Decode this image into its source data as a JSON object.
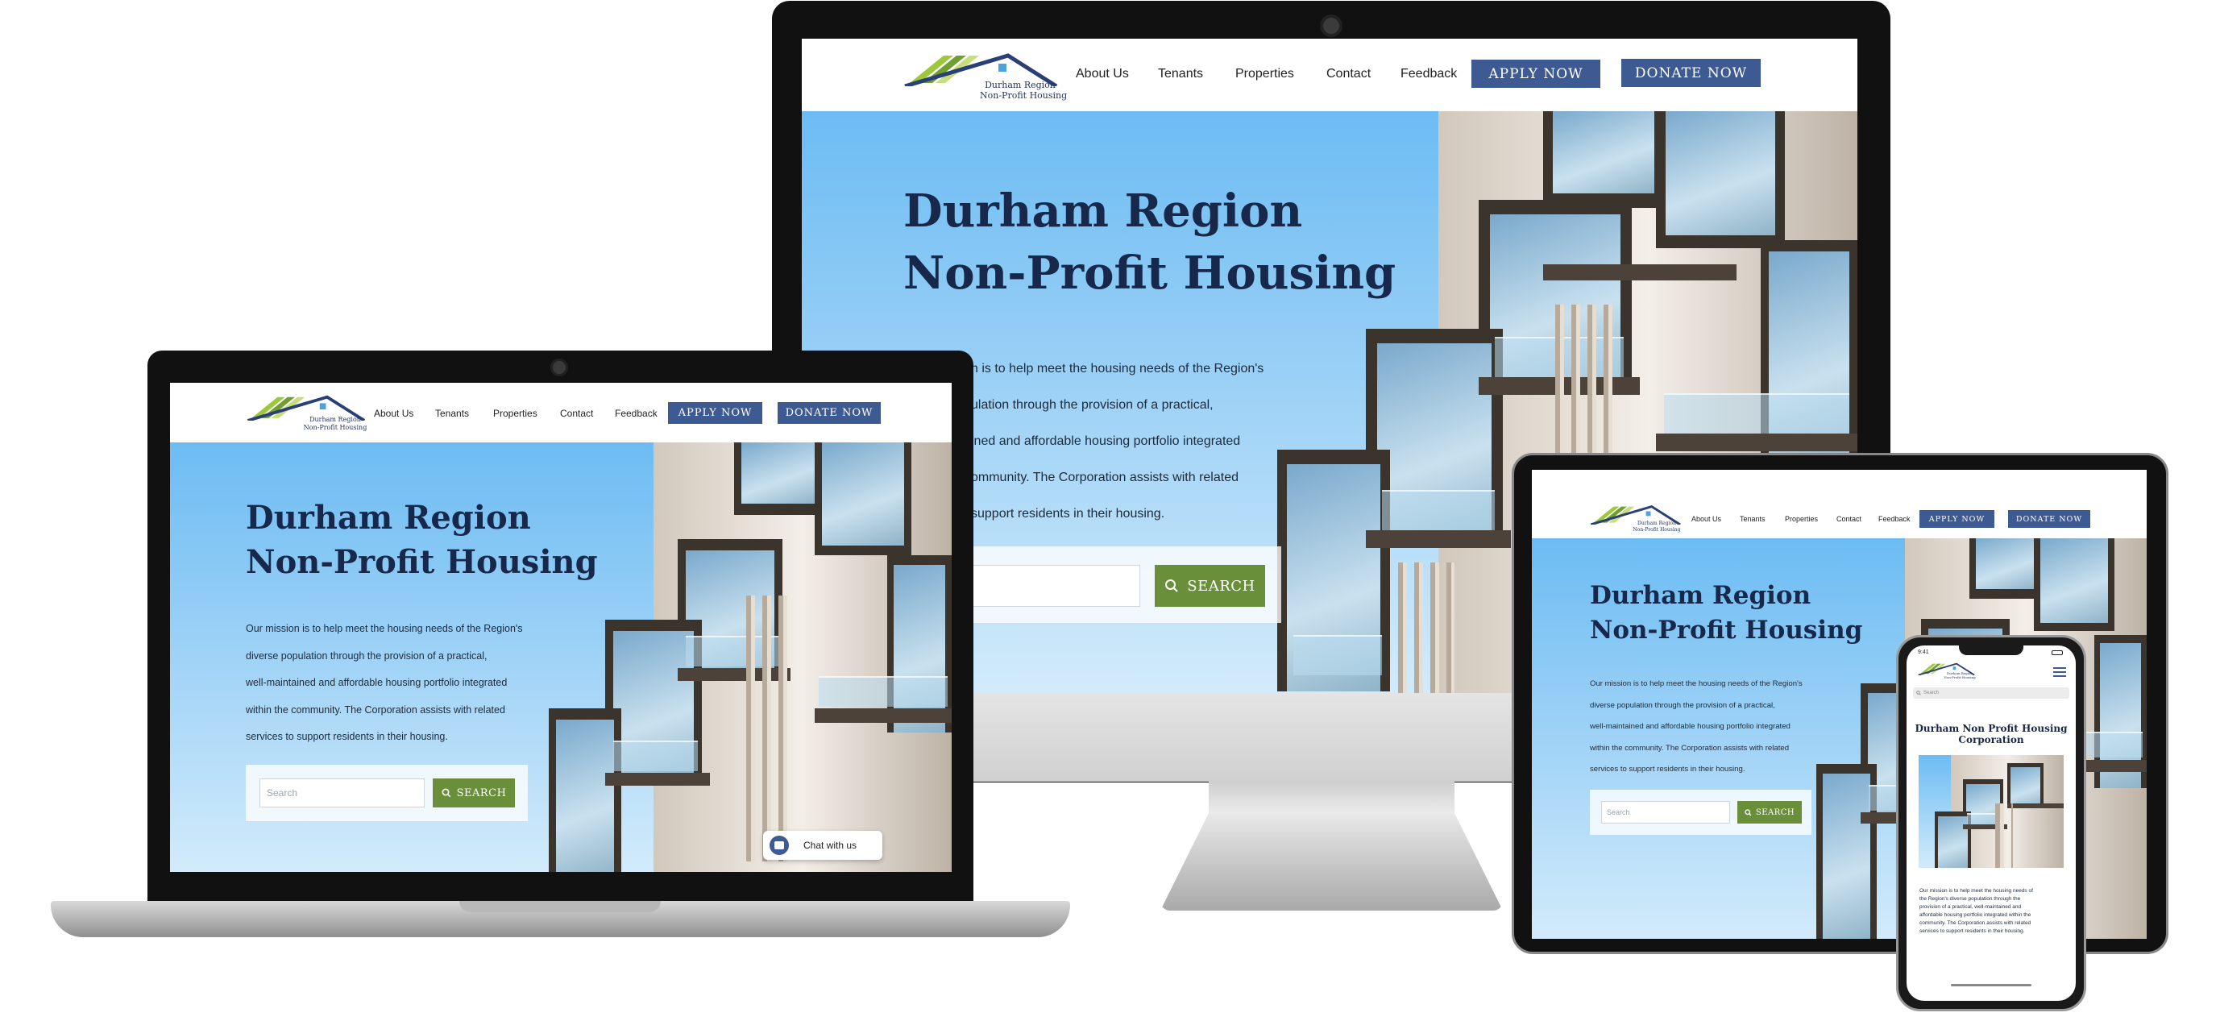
{
  "site": {
    "logo_line1": "Durham Region",
    "logo_line2": "Non-Profit Housing",
    "nav": [
      "About Us",
      "Tenants",
      "Properties",
      "Contact",
      "Feedback"
    ],
    "apply_label": "APPLY NOW",
    "donate_label": "DONATE NOW",
    "hero_title_line1": "Durham Region",
    "hero_title_line2": "Non-Profit Housing",
    "mission": [
      "Our mission is to help meet the housing needs of the Region's",
      "diverse population through the provision of a practical,",
      "well-maintained and affordable housing portfolio integrated",
      "within the community.  The Corporation assists with related",
      "services to support residents in their housing."
    ],
    "monitor_mission": [
      "n is to help meet the housing needs of the Region's",
      "ulation through the provision of a practical,",
      "ined and affordable housing portfolio integrated",
      "ommunity.  The Corporation assists with related",
      "support residents in their housing."
    ],
    "search_placeholder": "Search",
    "search_label": "SEARCH",
    "chat_label": "Chat with us"
  },
  "mobile": {
    "time": "9:41",
    "search_placeholder": "Search",
    "title_line1": "Durham Non Profit Housing",
    "title_line2": "Corporation",
    "mission": [
      "Our mission is to help meet the housing needs of",
      "the Region's diverse population through the",
      "provision of a practical, well-maintained and",
      "affordable housing portfolio integrated within the",
      "community.  The Corporation assists with related",
      "services to support residents in their housing."
    ]
  },
  "colors": {
    "navy": "#17284a",
    "button_blue": "#3d5a93",
    "search_green": "#6a8f3a",
    "sky": "#8ccaf5"
  }
}
